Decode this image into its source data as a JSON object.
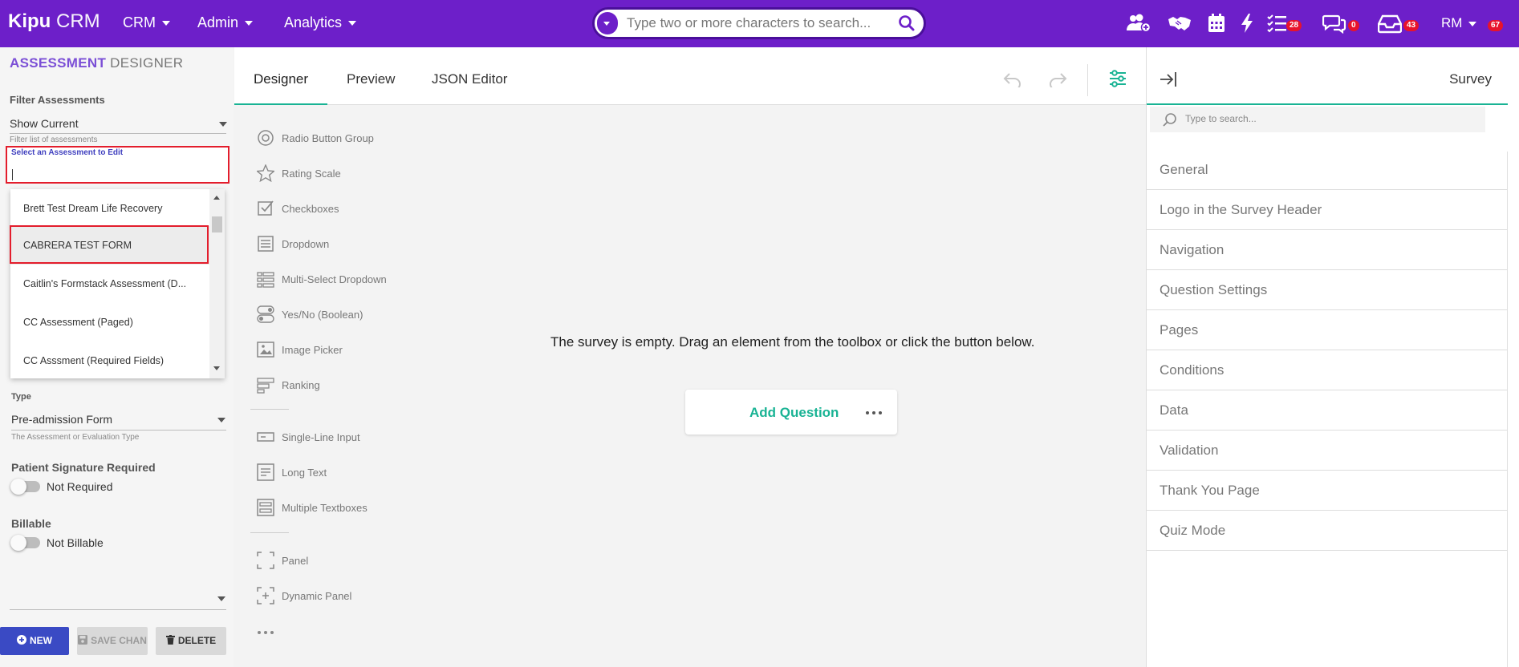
{
  "topbar": {
    "brand_bold": "Kipu",
    "brand_light": " CRM",
    "nav": [
      {
        "label": "CRM"
      },
      {
        "label": "Admin"
      },
      {
        "label": "Analytics"
      }
    ],
    "search_placeholder": "Type two or more characters to search...",
    "badges": {
      "tasks": "28",
      "messages": "0",
      "inbox": "43",
      "user": "67"
    },
    "user_initials": "RM"
  },
  "left": {
    "title_bold": "ASSESSMENT",
    "title_rest": " DESIGNER",
    "filter_label": "Filter Assessments",
    "filter_value": "Show Current",
    "filter_hint": "Filter list of assessments",
    "edit_label": "Select an Assessment to Edit",
    "list": [
      {
        "label": "Brett Test Dream Life Recovery"
      },
      {
        "label": "CABRERA TEST FORM"
      },
      {
        "label": "Caitlin's Formstack Assessment (D..."
      },
      {
        "label": "CC Assessment (Paged)"
      },
      {
        "label": "CC Asssment (Required Fields)"
      }
    ],
    "type_label": "Type",
    "type_value": "Pre-admission Form",
    "type_hint": "The Assessment or Evaluation Type",
    "signature_label": "Patient Signature Required",
    "signature_value": "Not Required",
    "billable_label": "Billable",
    "billable_value": "Not Billable",
    "buttons": {
      "new": "NEW",
      "save": "SAVE CHAN",
      "delete": "DELETE"
    }
  },
  "designer": {
    "tabs": [
      {
        "label": "Designer"
      },
      {
        "label": "Preview"
      },
      {
        "label": "JSON Editor"
      }
    ],
    "toolbox": [
      {
        "label": "Radio Button Group"
      },
      {
        "label": "Rating Scale"
      },
      {
        "label": "Checkboxes"
      },
      {
        "label": "Dropdown"
      },
      {
        "label": "Multi-Select Dropdown"
      },
      {
        "label": "Yes/No (Boolean)"
      },
      {
        "label": "Image Picker"
      },
      {
        "label": "Ranking"
      },
      {
        "label": "Single-Line Input"
      },
      {
        "label": "Long Text"
      },
      {
        "label": "Multiple Textboxes"
      },
      {
        "label": "Panel"
      },
      {
        "label": "Dynamic Panel"
      }
    ],
    "empty_message": "The survey is empty. Drag an element from the toolbox or click the button below.",
    "add_question": "Add Question"
  },
  "properties": {
    "title": "Survey",
    "search_placeholder": "Type to search...",
    "sections": [
      {
        "label": "General"
      },
      {
        "label": "Logo in the Survey Header"
      },
      {
        "label": "Navigation"
      },
      {
        "label": "Question Settings"
      },
      {
        "label": "Pages"
      },
      {
        "label": "Conditions"
      },
      {
        "label": "Data"
      },
      {
        "label": "Validation"
      },
      {
        "label": "Thank You Page"
      },
      {
        "label": "Quiz Mode"
      }
    ]
  },
  "colors": {
    "brand_purple": "#6d1fc9",
    "accent_green": "#19b394",
    "badge_red": "#e8132b",
    "highlight_red": "#e31d2c",
    "button_blue": "#3a4ac4"
  }
}
